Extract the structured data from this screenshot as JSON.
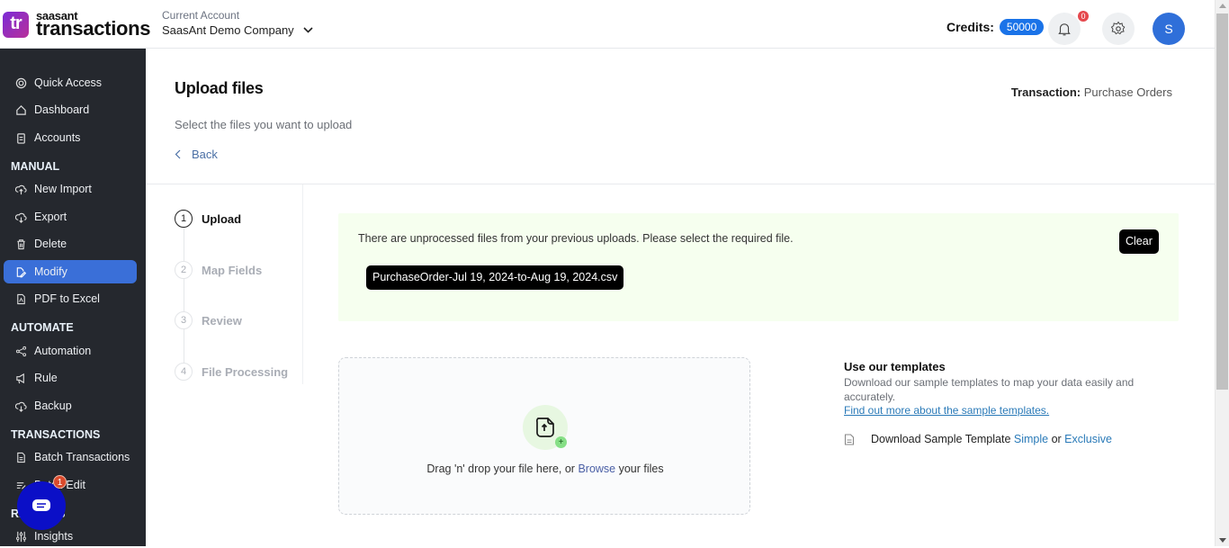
{
  "brand": {
    "logo_text": "tr",
    "small": "saasant",
    "big": "transactions"
  },
  "account": {
    "label": "Current Account",
    "name": "SaasAnt Demo Company"
  },
  "header": {
    "credits_label": "Credits:",
    "credits_value": "50000",
    "notifications_count": "0",
    "avatar_initial": "S"
  },
  "sidebar": {
    "items": [
      {
        "label": "Quick Access",
        "icon": "target-icon"
      },
      {
        "label": "Dashboard",
        "icon": "home-icon"
      },
      {
        "label": "Accounts",
        "icon": "clipboard-icon"
      },
      {
        "label": "New Import",
        "icon": "cloud-upload-icon"
      },
      {
        "label": "Export",
        "icon": "cloud-download-icon"
      },
      {
        "label": "Delete",
        "icon": "trash-icon"
      },
      {
        "label": "Modify",
        "icon": "edit-file-icon",
        "active": true
      },
      {
        "label": "PDF to Excel",
        "icon": "pdf-icon"
      },
      {
        "label": "Automation",
        "icon": "share-nodes-icon"
      },
      {
        "label": "Rule",
        "icon": "megaphone-icon"
      },
      {
        "label": "Backup",
        "icon": "cloud-backup-icon"
      },
      {
        "label": "Batch Transactions",
        "icon": "document-icon"
      },
      {
        "label": "Batch Edit",
        "icon": "edit-lines-icon"
      },
      {
        "label": "Insights",
        "icon": "sliders-icon"
      }
    ],
    "sections": {
      "manual": "MANUAL",
      "automate": "AUTOMATE",
      "transactions": "TRANSACTIONS",
      "reports": "REPORTS"
    },
    "chat_badge": "1"
  },
  "page": {
    "title": "Upload files",
    "subtitle": "Select the files you want to upload",
    "back_label": "Back",
    "transaction_label": "Transaction:",
    "transaction_value": "Purchase Orders"
  },
  "steps": [
    {
      "num": "1",
      "label": "Upload",
      "active": true
    },
    {
      "num": "2",
      "label": "Map Fields"
    },
    {
      "num": "3",
      "label": "Review"
    },
    {
      "num": "4",
      "label": "File Processing"
    }
  ],
  "notice": {
    "text": "There are unprocessed files from your previous uploads. Please select the required file.",
    "file": "PurchaseOrder-Jul 19, 2024-to-Aug 19, 2024.csv",
    "clear_label": "Clear"
  },
  "dropzone": {
    "text_before": "Drag 'n' drop your file here, or ",
    "browse": "Browse",
    "text_after": " your files"
  },
  "templates": {
    "title": "Use our templates",
    "description": "Download our sample templates to map your data easily and accurately.",
    "link": "Find out more about the sample templates.",
    "download_prefix": "Download Sample Template ",
    "simple": "Simple",
    "or": " or ",
    "exclusive": "Exclusive"
  }
}
